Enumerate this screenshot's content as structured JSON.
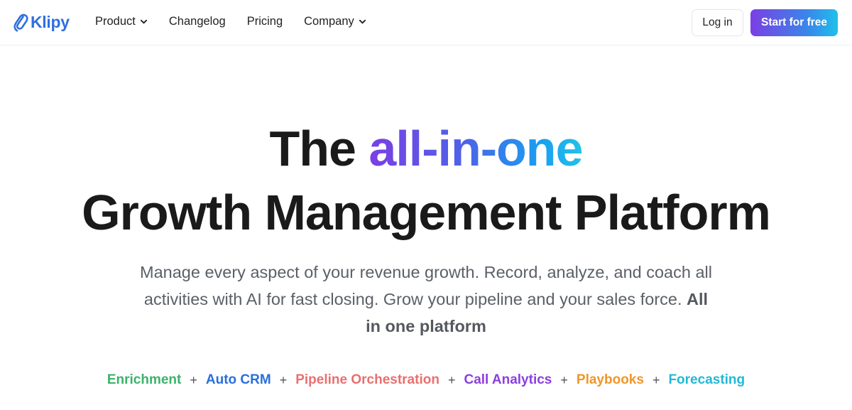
{
  "brand": {
    "name": "Klipy",
    "color": "#2f6fe0",
    "icon": "paperclip-icon"
  },
  "nav": {
    "items": [
      {
        "label": "Product",
        "has_dropdown": true
      },
      {
        "label": "Changelog",
        "has_dropdown": false
      },
      {
        "label": "Pricing",
        "has_dropdown": false
      },
      {
        "label": "Company",
        "has_dropdown": true
      }
    ],
    "login_label": "Log in",
    "cta_label": "Start for free",
    "cta_gradient": [
      "#7b3fe4",
      "#3a86ea",
      "#1fc0ea"
    ]
  },
  "hero": {
    "title_prefix": "The ",
    "title_highlight": "all-in-one",
    "title_line2": "Growth Management Platform",
    "subtitle_text": "Manage every aspect of your revenue growth. Record, analyze, and coach all activities with AI for fast closing. Grow your pipeline and your sales force. ",
    "subtitle_bold": "All in one platform"
  },
  "features": {
    "separator": "+",
    "items": [
      {
        "label": "Enrichment",
        "color": "#3bb26b"
      },
      {
        "label": "Auto CRM",
        "color": "#2a6fdb"
      },
      {
        "label": "Pipeline Orchestration",
        "color": "#e8706f"
      },
      {
        "label": "Call Analytics",
        "color": "#8b3fe0"
      },
      {
        "label": "Playbooks",
        "color": "#f0962b"
      },
      {
        "label": "Forecasting",
        "color": "#22b8d6"
      }
    ]
  }
}
